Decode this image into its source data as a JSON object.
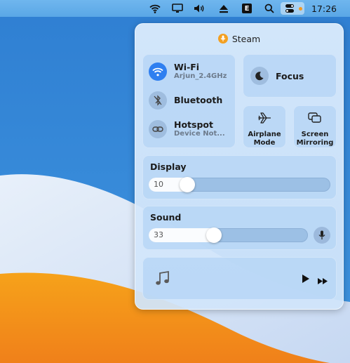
{
  "menubar": {
    "icons": [
      "wifi-icon",
      "display-icon",
      "volume-icon",
      "eject-icon",
      "e-app-icon",
      "search-icon",
      "control-center-icon"
    ],
    "e_label": "E",
    "clock": "17:26",
    "indicator_color": "#f39a24"
  },
  "control_center": {
    "app_name": "Steam",
    "network": {
      "wifi": {
        "title": "Wi-Fi",
        "subtitle": "Arjun_2.4GHz",
        "active": true
      },
      "bluetooth": {
        "title": "Bluetooth",
        "active": false
      },
      "hotspot": {
        "title": "Hotspot",
        "subtitle": "Device Not...",
        "active": false
      }
    },
    "focus": {
      "label": "Focus"
    },
    "airplane": {
      "label_line1": "Airplane",
      "label_line2": "Mode"
    },
    "screen_mirroring": {
      "label_line1": "Screen",
      "label_line2": "Mirroring"
    },
    "display": {
      "title": "Display",
      "value": "10",
      "level": 0.1
    },
    "sound": {
      "title": "Sound",
      "value": "33",
      "level": 0.33
    },
    "media": {
      "icons": [
        "music-note-icon",
        "play-icon",
        "fast-forward-icon"
      ]
    }
  },
  "colors": {
    "accent": "#2f7ff0",
    "mic_badge": "#f3a021",
    "panel_bg": "#d6e8fb"
  }
}
